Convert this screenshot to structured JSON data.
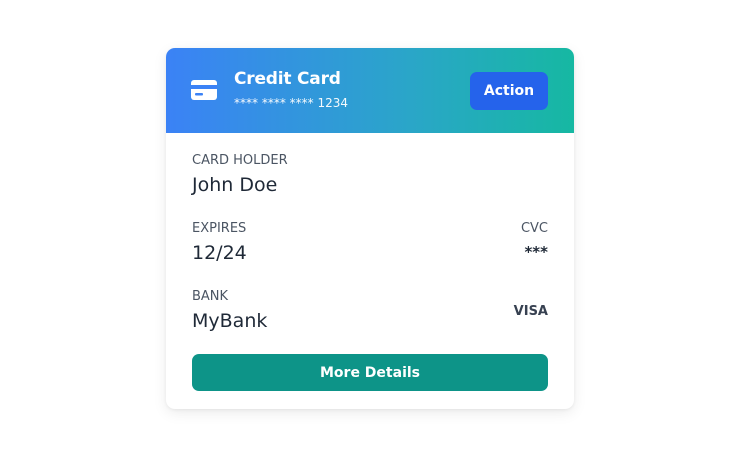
{
  "header": {
    "title": "Credit Card",
    "masked_number": "**** **** **** 1234",
    "action_label": "Action",
    "icon": "credit-card-icon"
  },
  "fields": {
    "card_holder": {
      "label": "CARD HOLDER",
      "value": "John Doe"
    },
    "expires": {
      "label": "EXPIRES",
      "value": "12/24"
    },
    "cvc": {
      "label": "CVC",
      "value": "***"
    },
    "bank": {
      "label": "BANK",
      "value": "MyBank"
    },
    "brand": "VISA"
  },
  "footer": {
    "more_label": "More Details"
  },
  "colors": {
    "header_gradient_start": "#3b82f6",
    "header_gradient_end": "#16b8a2",
    "action_button": "#2563eb",
    "more_button": "#0d9488"
  }
}
